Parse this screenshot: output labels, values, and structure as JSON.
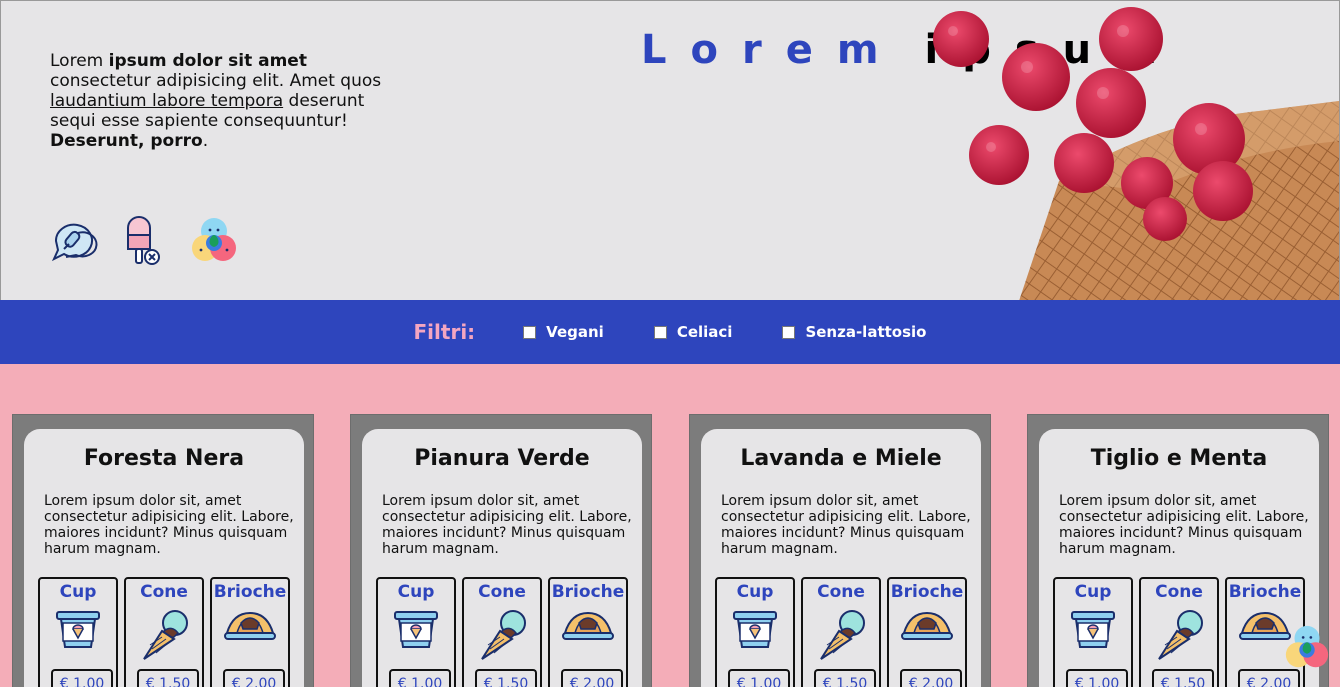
{
  "hero": {
    "intro_1": "Lorem ",
    "intro_2": "ipsum dolor sit amet",
    "intro_3": " consectetur adipisicing elit. Amet quos ",
    "intro_4": "laudantium labore tempora",
    "intro_5": " deserunt sequi esse sapiente consequuntur! ",
    "intro_6": "Deserunt, porro",
    "intro_7": ".",
    "title_1": "Lorem",
    "title_2": "ipsum",
    "icons": [
      "chat-popsicle-icon",
      "popsicle-remove-icon",
      "ice-cream-scoops-icon"
    ],
    "image": "raspberry-waffle-cone-image"
  },
  "filters": {
    "label": "Filtri:",
    "options": [
      "Vegani",
      "Celiaci",
      "Senza-lattosio"
    ]
  },
  "cards": [
    {
      "title": "Foresta Nera",
      "desc": "Lorem ipsum dolor sit, amet consectetur adipisicing elit. Labore, maiores incidunt? Minus quisquam harum magnam.",
      "options": [
        {
          "name": "Cup",
          "price": "€ 1.00"
        },
        {
          "name": "Cone",
          "price": "€ 1.50"
        },
        {
          "name": "Brioche",
          "price": "€ 2.00"
        }
      ]
    },
    {
      "title": "Pianura Verde",
      "desc": "Lorem ipsum dolor sit, amet consectetur adipisicing elit. Labore, maiores incidunt? Minus quisquam harum magnam.",
      "options": [
        {
          "name": "Cup",
          "price": "€ 1.00"
        },
        {
          "name": "Cone",
          "price": "€ 1.50"
        },
        {
          "name": "Brioche",
          "price": "€ 2.00"
        }
      ]
    },
    {
      "title": "Lavanda e Miele",
      "desc": "Lorem ipsum dolor sit, amet consectetur adipisicing elit. Labore, maiores incidunt? Minus quisquam harum magnam.",
      "options": [
        {
          "name": "Cup",
          "price": "€ 1.00"
        },
        {
          "name": "Cone",
          "price": "€ 1.50"
        },
        {
          "name": "Brioche",
          "price": "€ 2.00"
        }
      ]
    },
    {
      "title": "Tiglio e Menta",
      "desc": "Lorem ipsum dolor sit, amet consectetur adipisicing elit. Labore, maiores incidunt? Minus quisquam harum magnam.",
      "options": [
        {
          "name": "Cup",
          "price": "€ 1.00"
        },
        {
          "name": "Cone",
          "price": "€ 1.50"
        },
        {
          "name": "Brioche",
          "price": "€ 2.00"
        }
      ]
    }
  ],
  "colors": {
    "brand_blue": "#2e45bd",
    "pink_bg": "#f4adb8",
    "filter_label_pink": "#f4a6c1",
    "card_bg": "#e6e5e7",
    "card_frame": "#7c7c7c"
  }
}
